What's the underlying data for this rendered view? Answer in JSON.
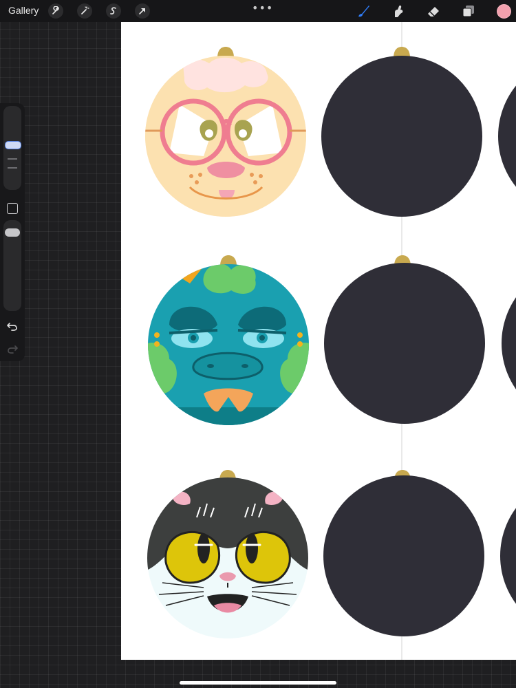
{
  "toolbar": {
    "gallery_label": "Gallery",
    "left_tools": [
      "wrench-icon",
      "magic-wand-icon",
      "selection-icon",
      "transform-arrow-icon"
    ],
    "more_label": "•••",
    "right_tools": [
      "brush-icon",
      "smudge-icon",
      "eraser-icon",
      "layers-icon"
    ],
    "active_tool": "brush",
    "brush_color": "#2f7cf6",
    "current_color": "#f2a1ae"
  },
  "sidebar": {
    "brush_size_thumb": "size-slider",
    "brush_opacity_thumb": "opacity-slider",
    "modify_button": "modify-square-icon",
    "undo": "undo-icon",
    "redo": "redo-icon"
  },
  "canvas": {
    "background": "#ffffff",
    "ornament_fill": "#2f2e37",
    "cap_color": "#c8a94f",
    "guide_color": "#d3d3d3",
    "artworks": [
      "dog-face-with-pink-glasses",
      "teal-dragon-face",
      "black-white-cat-face"
    ]
  }
}
